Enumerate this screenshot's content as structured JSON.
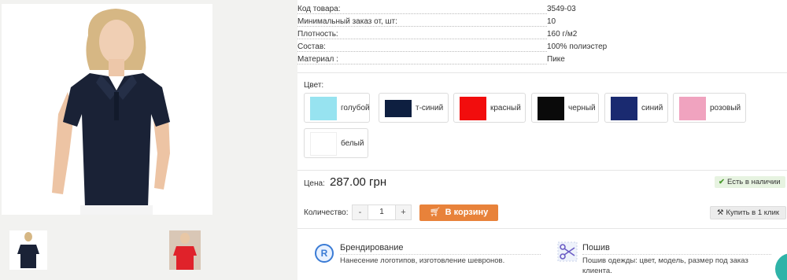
{
  "specs": [
    {
      "key": "Код товара:",
      "value": "3549-03"
    },
    {
      "key": "Минимальный заказ от, шт:",
      "value": "10"
    },
    {
      "key": "Плотность:",
      "value": "160 г/м2"
    },
    {
      "key": "Состав:",
      "value": "100% полиэстер"
    },
    {
      "key": "Материал :",
      "value": "Пике"
    }
  ],
  "colors": {
    "label": "Цвет:",
    "options": [
      {
        "name": "голубой",
        "hex": "#97e3f0"
      },
      {
        "name": "т-синий",
        "hex": "#0e1f40"
      },
      {
        "name": "красный",
        "hex": "#f20d0d"
      },
      {
        "name": "черный",
        "hex": "#0a0a0a"
      },
      {
        "name": "синий",
        "hex": "#1a2a70"
      },
      {
        "name": "розовый",
        "hex": "#f0a3bf"
      },
      {
        "name": "белый",
        "hex": "#ffffff"
      }
    ]
  },
  "price": {
    "label": "Цена:",
    "value": "287.00 грн",
    "stock": "Есть в наличии"
  },
  "cart": {
    "qty_label": "Количество:",
    "minus": "-",
    "qty": "1",
    "plus": "+",
    "add_label": "В корзину",
    "one_click_label": "Купить в 1 клик"
  },
  "services": [
    {
      "title": "Брендирование",
      "text": "Нанесение логотипов, изготовление шевронов.",
      "icon": "registered-icon"
    },
    {
      "title": "Пошив",
      "text": "Пошив одежды: цвет, модель, размер под заказ клиента.",
      "icon": "scissors-icon"
    }
  ],
  "icons": {
    "stock": "check-icon",
    "cart": "cart-icon",
    "one_click": "hammer-icon"
  }
}
